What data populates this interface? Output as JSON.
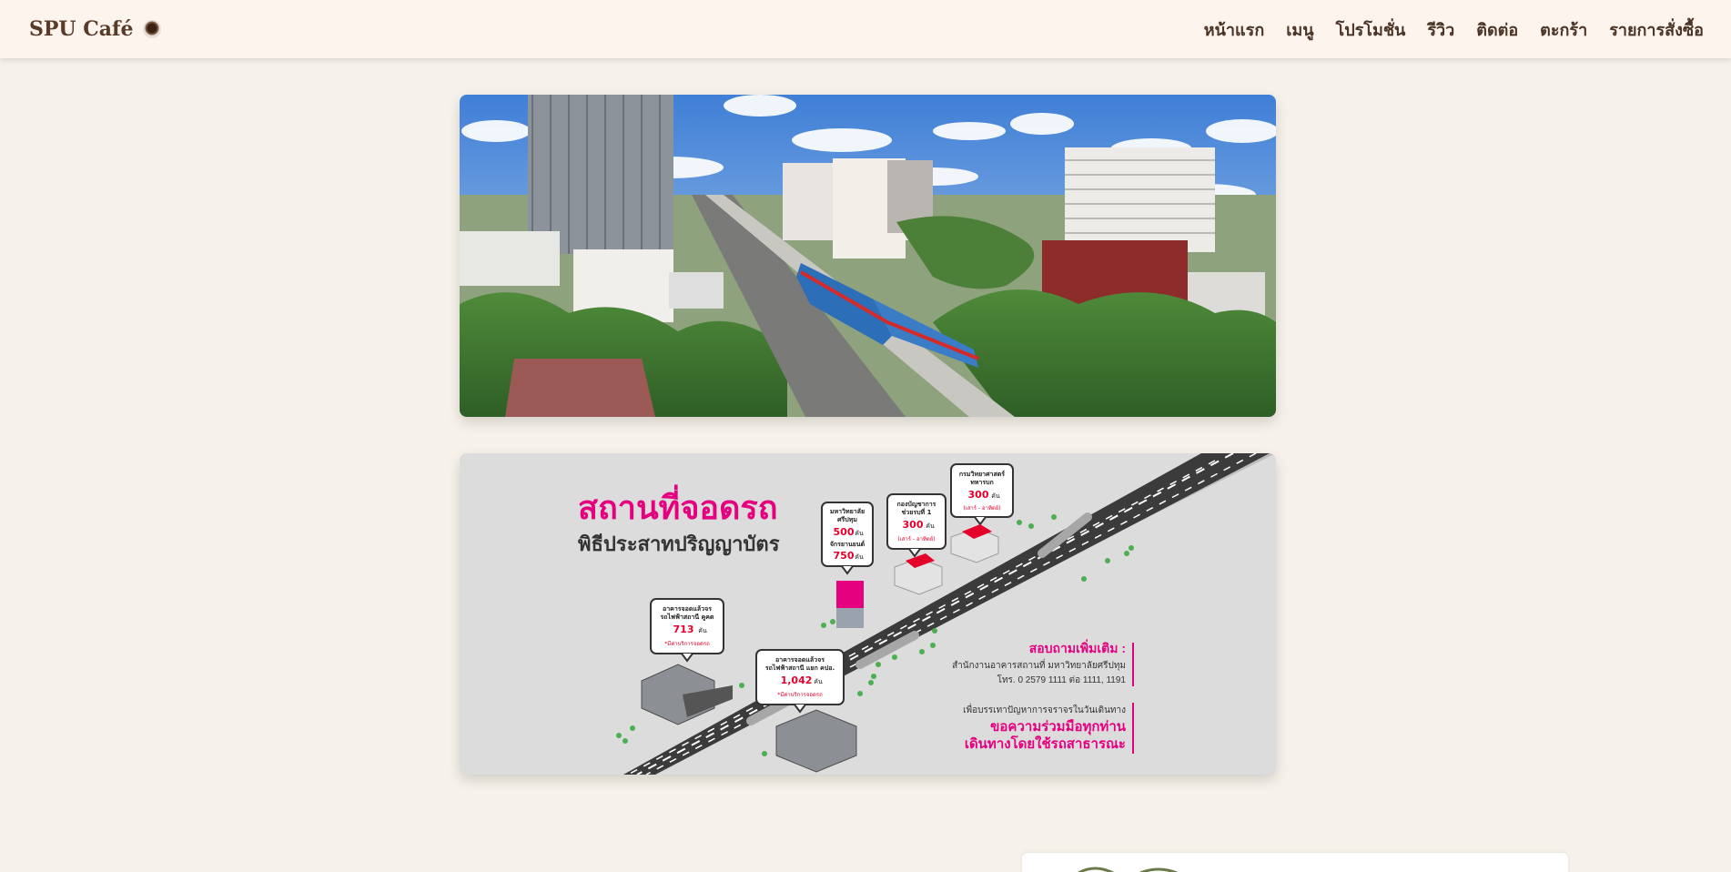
{
  "brand": {
    "name": "SPU Café",
    "icon": "coffee-cup-icon"
  },
  "nav": {
    "items": [
      {
        "label": "หน้าแรก"
      },
      {
        "label": "เมนู"
      },
      {
        "label": "โปรโมชั่น"
      },
      {
        "label": "รีวิว"
      },
      {
        "label": "ติดต่อ"
      },
      {
        "label": "ตะกร้า"
      },
      {
        "label": "รายการสั่งซื้อ"
      }
    ]
  },
  "parking": {
    "title": "สถานที่จอดรถ",
    "subtitle": "พิธีประสาทปริญญาบัตร",
    "callouts": [
      {
        "lines": [
          "มหาวิทยาลัย",
          "ศรีปทุม"
        ],
        "count": "500",
        "unit": "คัน",
        "extra": [
          "จักรยานยนต์"
        ],
        "count2": "750",
        "unit2": "คัน"
      },
      {
        "lines": [
          "กองบัญชาการ",
          "ช่วยรบที่ 1"
        ],
        "count": "300",
        "unit": "คัน",
        "note": "(เสาร์ - อาทิตย์)"
      },
      {
        "lines": [
          "กรมวิทยาศาสตร์",
          "ทหารบก"
        ],
        "count": "300",
        "unit": "คัน",
        "note": "(เสาร์ - อาทิตย์)"
      },
      {
        "lines": [
          "อาคารจอดแล้วจร",
          "รถไฟฟ้าสถานี คูคต"
        ],
        "count": "713",
        "unit": "คัน",
        "note": "*มีค่าบริการจอดรถ"
      },
      {
        "lines": [
          "อาคารจอดแล้วจร",
          "รถไฟฟ้าสถานี แยก คปอ."
        ],
        "count": "1,042",
        "unit": "คัน",
        "note": "*มีค่าบริการจอดรถ"
      }
    ],
    "inquiry": {
      "heading": "สอบถามเพิ่มเติม :",
      "line1": "สำนักงานอาคารสถานที่ มหาวิทยาลัยศรีปทุม",
      "line2": "โทร. 0 2579 1111 ต่อ 1111, 1191"
    },
    "appeal": {
      "line1": "เพื่อบรรเทาปัญหาการจราจรในวันเดินทาง",
      "line2": "ขอความร่วมมือทุกท่าน",
      "line3": "เดินทางโดยใช้รถสาธารณะ"
    },
    "colors": {
      "pink": "#e4007f",
      "red": "#e5002b",
      "green": "#2e9c4a",
      "road": "#3b3b3b"
    }
  }
}
